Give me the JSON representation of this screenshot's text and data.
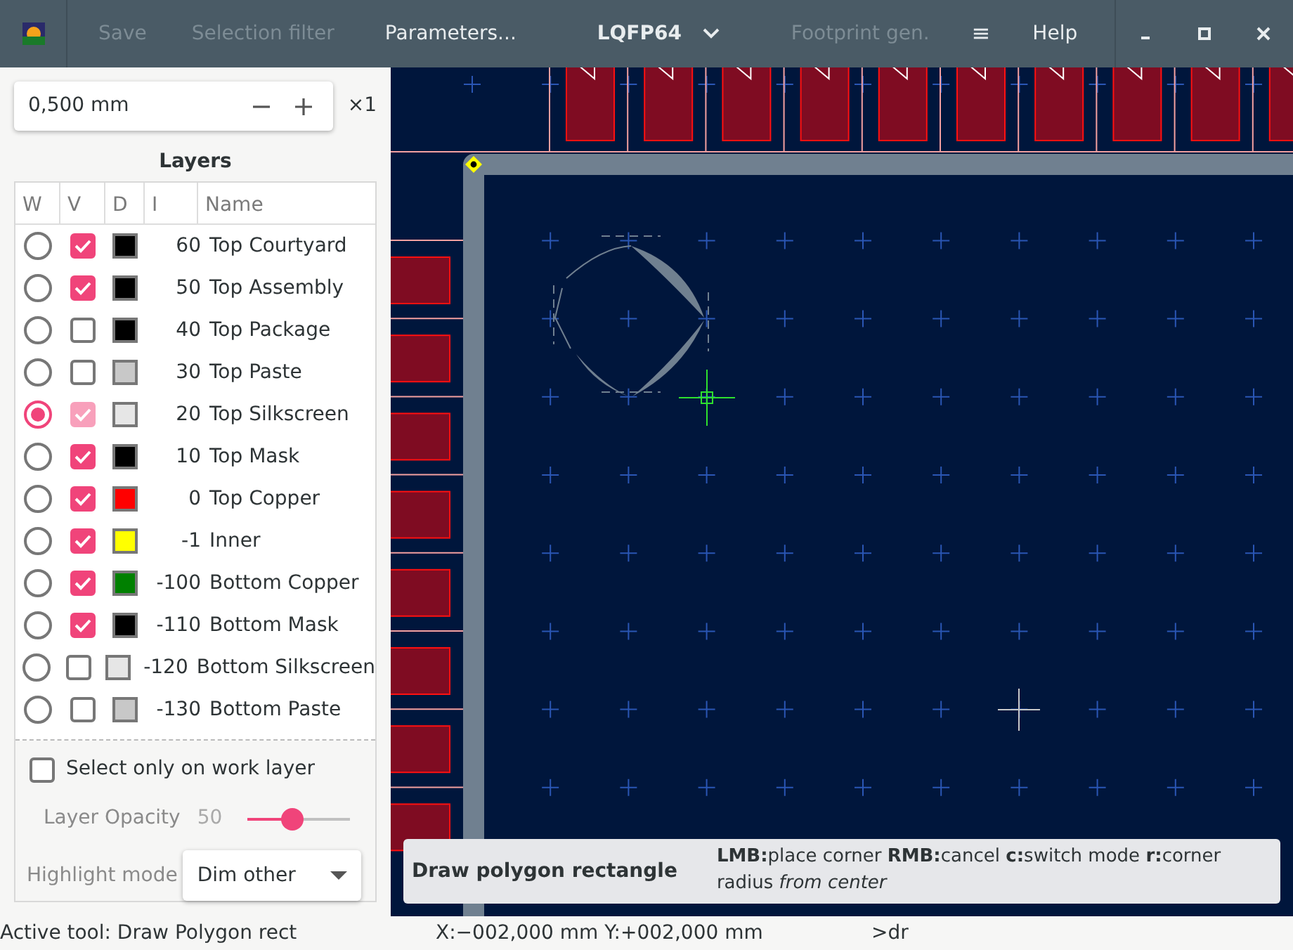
{
  "header": {
    "buttons": [
      {
        "label": "Save",
        "disabled": true
      },
      {
        "label": "Selection filter",
        "disabled": true
      },
      {
        "label": "Parameters...",
        "disabled": false
      }
    ],
    "title": "LQFP64",
    "buttons_right": [
      {
        "label": "Footprint gen.",
        "disabled": true
      },
      {
        "label": "≡",
        "disabled": false
      },
      {
        "label": "Help",
        "disabled": false
      }
    ]
  },
  "sidebar": {
    "grid_field": {
      "value": "0,500 mm",
      "multiplier": "×1"
    },
    "layers_title": "Layers",
    "columns": [
      "W",
      "V",
      "D",
      "I",
      "Name"
    ],
    "layers": [
      {
        "index": "60",
        "name": "Top Courtyard",
        "selected": false,
        "visible": true,
        "color": "#000000"
      },
      {
        "index": "50",
        "name": "Top Assembly",
        "selected": false,
        "visible": true,
        "color": "#000000"
      },
      {
        "index": "40",
        "name": "Top Package",
        "selected": false,
        "visible": false,
        "color": "#000000"
      },
      {
        "index": "30",
        "name": "Top Paste",
        "selected": false,
        "visible": false,
        "color": "#c8c8c8"
      },
      {
        "index": "20",
        "name": "Top Silkscreen",
        "selected": true,
        "visible": true,
        "color": "#e6e6e6"
      },
      {
        "index": "10",
        "name": "Top Mask",
        "selected": false,
        "visible": true,
        "color": "#000000"
      },
      {
        "index": "0",
        "name": "Top Copper",
        "selected": false,
        "visible": true,
        "color": "#ff0000"
      },
      {
        "index": "-1",
        "name": "Inner",
        "selected": false,
        "visible": true,
        "color": "#ffff00"
      },
      {
        "index": "-100",
        "name": "Bottom Copper",
        "selected": false,
        "visible": true,
        "color": "#008000"
      },
      {
        "index": "-110",
        "name": "Bottom Mask",
        "selected": false,
        "visible": true,
        "color": "#000000"
      },
      {
        "index": "-120",
        "name": "Bottom Silkscreen",
        "selected": false,
        "visible": false,
        "color": "#e6e6e6"
      },
      {
        "index": "-130",
        "name": "Bottom Paste",
        "selected": false,
        "visible": false,
        "color": "#c8c8c8"
      }
    ],
    "select_only_work_layer": {
      "label": "Select only on work layer",
      "checked": false
    },
    "opacity": {
      "label": "Layer Opacity",
      "reading": "50",
      "level": 0.44
    },
    "highlight": {
      "label": "Highlight mode",
      "value": "Dim other"
    }
  },
  "tooltip": {
    "title": "Draw polygon rectangle",
    "text": "**LMB:**place corner **RMB:**cancel **c:**switch mode **r:**corner radius *from center*"
  },
  "status_bar": {
    "tool": "Active tool: Draw Polygon rect",
    "coordinates": "X:−002,000 mm Y:+002,000 mm",
    "command": ">dr"
  }
}
